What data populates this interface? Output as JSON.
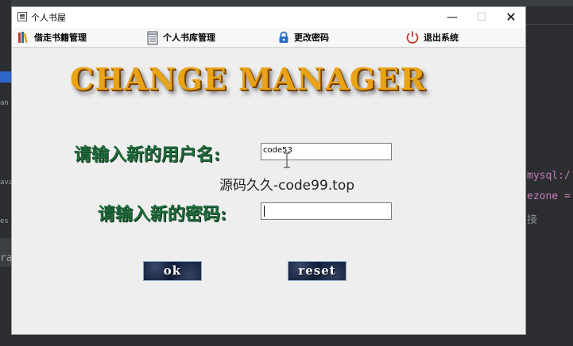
{
  "background": {
    "left_fragments": [
      "an",
      "ava",
      "es",
      "ra"
    ],
    "right_fragments": [
      "mysql:/",
      "ezone =",
      "接"
    ]
  },
  "window": {
    "title": "个人书屋",
    "controls": {
      "minimize": "—",
      "maximize": "☐",
      "close": "✕"
    }
  },
  "menu": {
    "borrow_label": "借走书籍管理",
    "library_label": "个人书库管理",
    "password_label": "更改密码",
    "exit_label": "退出系统"
  },
  "banner": "CHANGE MANAGER",
  "form": {
    "username_label": "请输入新的用户名:",
    "username_value": "code53",
    "password_label": "请输入新的密码:",
    "password_value": ""
  },
  "watermark": "源码久久-code99.top",
  "buttons": {
    "ok_label": "ok",
    "reset_label": "reset"
  },
  "colors": {
    "banner": "#e8a317",
    "label": "#1f6b3a",
    "button_bg": "#0f1a33"
  }
}
